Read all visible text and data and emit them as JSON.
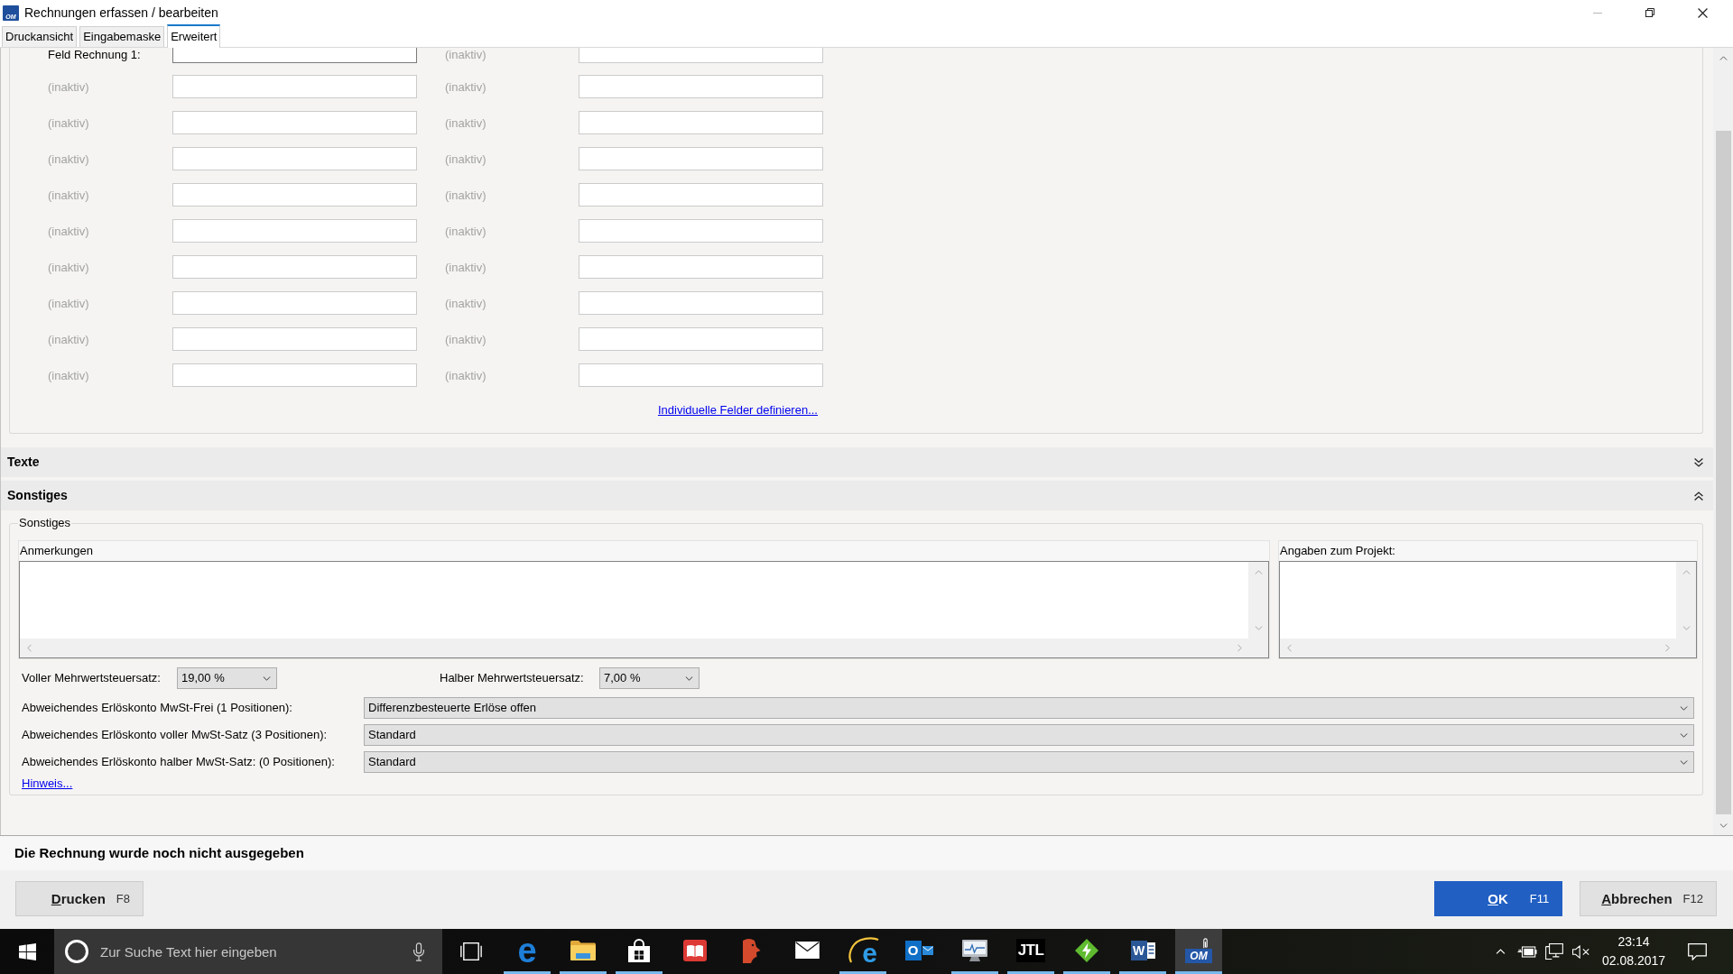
{
  "window": {
    "title": "Rechnungen erfassen / bearbeiten",
    "icon_text": "OM"
  },
  "tabs": [
    {
      "label": "Druckansicht",
      "selected": false
    },
    {
      "label": "Eingabemaske",
      "selected": false
    },
    {
      "label": "Erweitert",
      "selected": true
    }
  ],
  "custom_fields": {
    "rows": [
      {
        "cells": [
          {
            "label": "Feld Rechnung 1:",
            "disabled": false,
            "focused": true
          },
          {
            "label": "(inaktiv)",
            "disabled": true,
            "focused": false
          }
        ]
      },
      {
        "cells": [
          {
            "label": "(inaktiv)",
            "disabled": true,
            "focused": false
          },
          {
            "label": "(inaktiv)",
            "disabled": true,
            "focused": false
          }
        ]
      },
      {
        "cells": [
          {
            "label": "(inaktiv)",
            "disabled": true,
            "focused": false
          },
          {
            "label": "(inaktiv)",
            "disabled": true,
            "focused": false
          }
        ]
      },
      {
        "cells": [
          {
            "label": "(inaktiv)",
            "disabled": true,
            "focused": false
          },
          {
            "label": "(inaktiv)",
            "disabled": true,
            "focused": false
          }
        ]
      },
      {
        "cells": [
          {
            "label": "(inaktiv)",
            "disabled": true,
            "focused": false
          },
          {
            "label": "(inaktiv)",
            "disabled": true,
            "focused": false
          }
        ]
      },
      {
        "cells": [
          {
            "label": "(inaktiv)",
            "disabled": true,
            "focused": false
          },
          {
            "label": "(inaktiv)",
            "disabled": true,
            "focused": false
          }
        ]
      },
      {
        "cells": [
          {
            "label": "(inaktiv)",
            "disabled": true,
            "focused": false
          },
          {
            "label": "(inaktiv)",
            "disabled": true,
            "focused": false
          }
        ]
      },
      {
        "cells": [
          {
            "label": "(inaktiv)",
            "disabled": true,
            "focused": false
          },
          {
            "label": "(inaktiv)",
            "disabled": true,
            "focused": false
          }
        ]
      },
      {
        "cells": [
          {
            "label": "(inaktiv)",
            "disabled": true,
            "focused": false
          },
          {
            "label": "(inaktiv)",
            "disabled": true,
            "focused": false
          }
        ]
      },
      {
        "cells": [
          {
            "label": "(inaktiv)",
            "disabled": true,
            "focused": false
          },
          {
            "label": "(inaktiv)",
            "disabled": true,
            "focused": false
          }
        ]
      }
    ],
    "link": "Individuelle Felder definieren..."
  },
  "sections": [
    {
      "title": "Texte",
      "expanded": false
    },
    {
      "title": "Sonstiges",
      "expanded": true,
      "group": {
        "legend": "Sonstiges",
        "text_areas": [
          {
            "label": "Anmerkungen"
          },
          {
            "label": "Angaben zum Projekt:"
          }
        ],
        "vat_rates": [
          {
            "label": "Voller Mehrwertsteuersatz:",
            "value": "19,00 %"
          },
          {
            "label": "Halber Mehrwertsteuersatz:",
            "value": "7,00 %"
          }
        ],
        "revenue_accounts": [
          {
            "label": "Abweichendes Erlöskonto MwSt-Frei (1 Positionen):",
            "value": "Differenzbesteuerte Erlöse offen"
          },
          {
            "label": "Abweichendes Erlöskonto voller MwSt-Satz (3 Positionen):",
            "value": "Standard"
          },
          {
            "label": "Abweichendes Erlöskonto halber MwSt-Satz: (0 Positionen):",
            "value": "Standard"
          }
        ],
        "link": "Hinweis..."
      }
    }
  ],
  "footer": {
    "status": "Die Rechnung wurde noch nicht ausgegeben",
    "left_buttons": [
      {
        "label": "Drucken",
        "shortcut": "F8",
        "kind": "secondary"
      }
    ],
    "right_buttons": [
      {
        "label": "OK",
        "shortcut": "F11",
        "kind": "primary"
      },
      {
        "label": "Abbrechen",
        "shortcut": "F12",
        "kind": "secondary"
      }
    ]
  },
  "taskbar": {
    "search": {
      "placeholder": "Zur Suche Text hier eingeben"
    },
    "apps": [
      {
        "kind": "letter",
        "logo_text": "e",
        "running": true,
        "selected": false
      },
      {
        "kind": "folder",
        "running": true,
        "selected": false
      },
      {
        "kind": "bag",
        "running": true,
        "selected": false
      },
      {
        "kind": "book",
        "running": false,
        "selected": false
      },
      {
        "kind": "head",
        "running": false,
        "selected": false
      },
      {
        "kind": "envelope",
        "running": false,
        "selected": false
      },
      {
        "kind": "ringed_letter",
        "logo_text": "e",
        "running": true,
        "selected": false
      },
      {
        "kind": "mail_tile",
        "logo_text": "O",
        "running": false,
        "selected": false
      },
      {
        "kind": "monitor",
        "running": true,
        "selected": false
      },
      {
        "kind": "text_tile",
        "logo_text": "JTL",
        "running": true,
        "selected": false
      },
      {
        "kind": "diamond",
        "running": true,
        "selected": false
      },
      {
        "kind": "page_tile",
        "logo_text": "W",
        "running": true,
        "selected": false
      },
      {
        "kind": "clip_tile",
        "logo_text": "OM",
        "running": true,
        "selected": true
      }
    ],
    "clock": {
      "time": "23:14",
      "date": "02.08.2017"
    }
  }
}
